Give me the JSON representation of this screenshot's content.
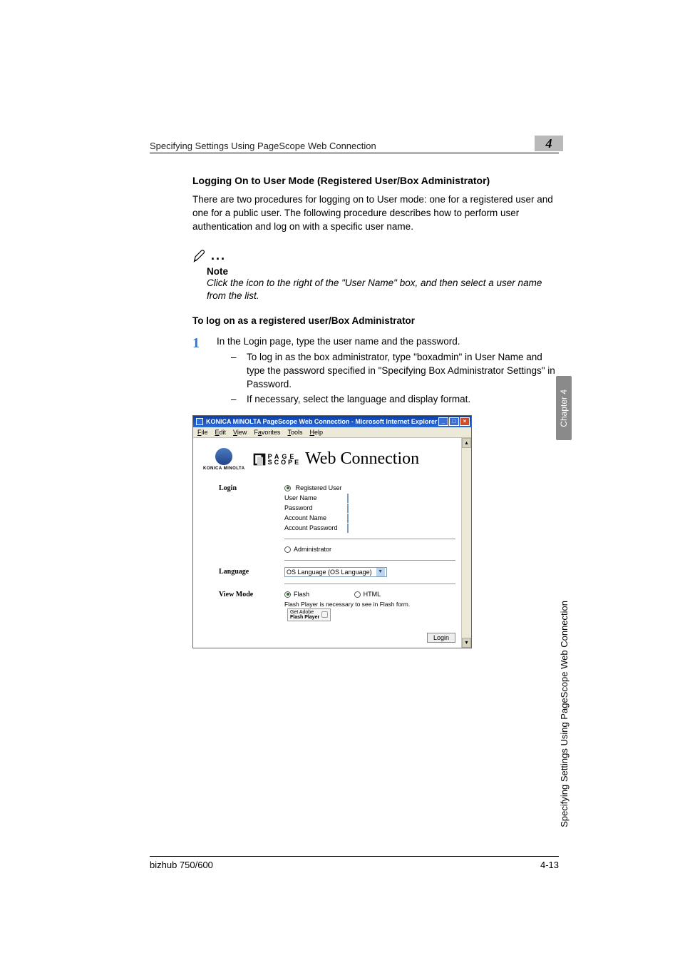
{
  "header": {
    "running_title": "Specifying Settings Using PageScope Web Connection",
    "chapter_number": "4"
  },
  "section": {
    "heading": "Logging On to User Mode (Registered User/Box Administrator)",
    "paragraph": "There are two procedures for logging on to User mode: one for a registered user and one for a public user. The following procedure describes how to perform user authentication and log on with a specific user name."
  },
  "note": {
    "label": "Note",
    "text": "Click the icon to the right of the \"User Name\" box, and then select a user name from the list."
  },
  "procedure": {
    "heading": "To log on as a registered user/Box Administrator",
    "step_number": "1",
    "step_lead": "In the Login page, type the user name and the password.",
    "bullet1": "To log in as the box administrator, type \"boxadmin\" in User Name and type the password specified in \"Specifying Box Administrator Settings\" in Password.",
    "bullet2": "If necessary, select the language and display format."
  },
  "screenshot": {
    "title": "KONICA MINOLTA PageScope Web Connection - Microsoft Internet Explorer",
    "menubar": {
      "file": "File",
      "edit": "Edit",
      "view": "View",
      "favorites": "Favorites",
      "tools": "Tools",
      "help": "Help"
    },
    "brand": {
      "konica": "KONICA MINOLTA",
      "page": "PAGE",
      "scope": "SCOPE",
      "webconnection": "Web Connection"
    },
    "form": {
      "login_label": "Login",
      "registered_user": "Registered User",
      "user_name": "User Name",
      "password": "Password",
      "account_name": "Account Name",
      "account_password": "Account Password",
      "administrator": "Administrator",
      "language_label": "Language",
      "language_value": "OS Language (OS Language)",
      "viewmode_label": "View Mode",
      "flash": "Flash",
      "html": "HTML",
      "flash_note": "Flash Player is necessary to see in Flash form.",
      "get_adobe": "Get Adobe Flash Player",
      "login_button": "Login"
    }
  },
  "side": {
    "tab": "Chapter 4",
    "text": "Specifying Settings Using PageScope Web Connection"
  },
  "footer": {
    "product": "bizhub 750/600",
    "page_number": "4-13"
  }
}
